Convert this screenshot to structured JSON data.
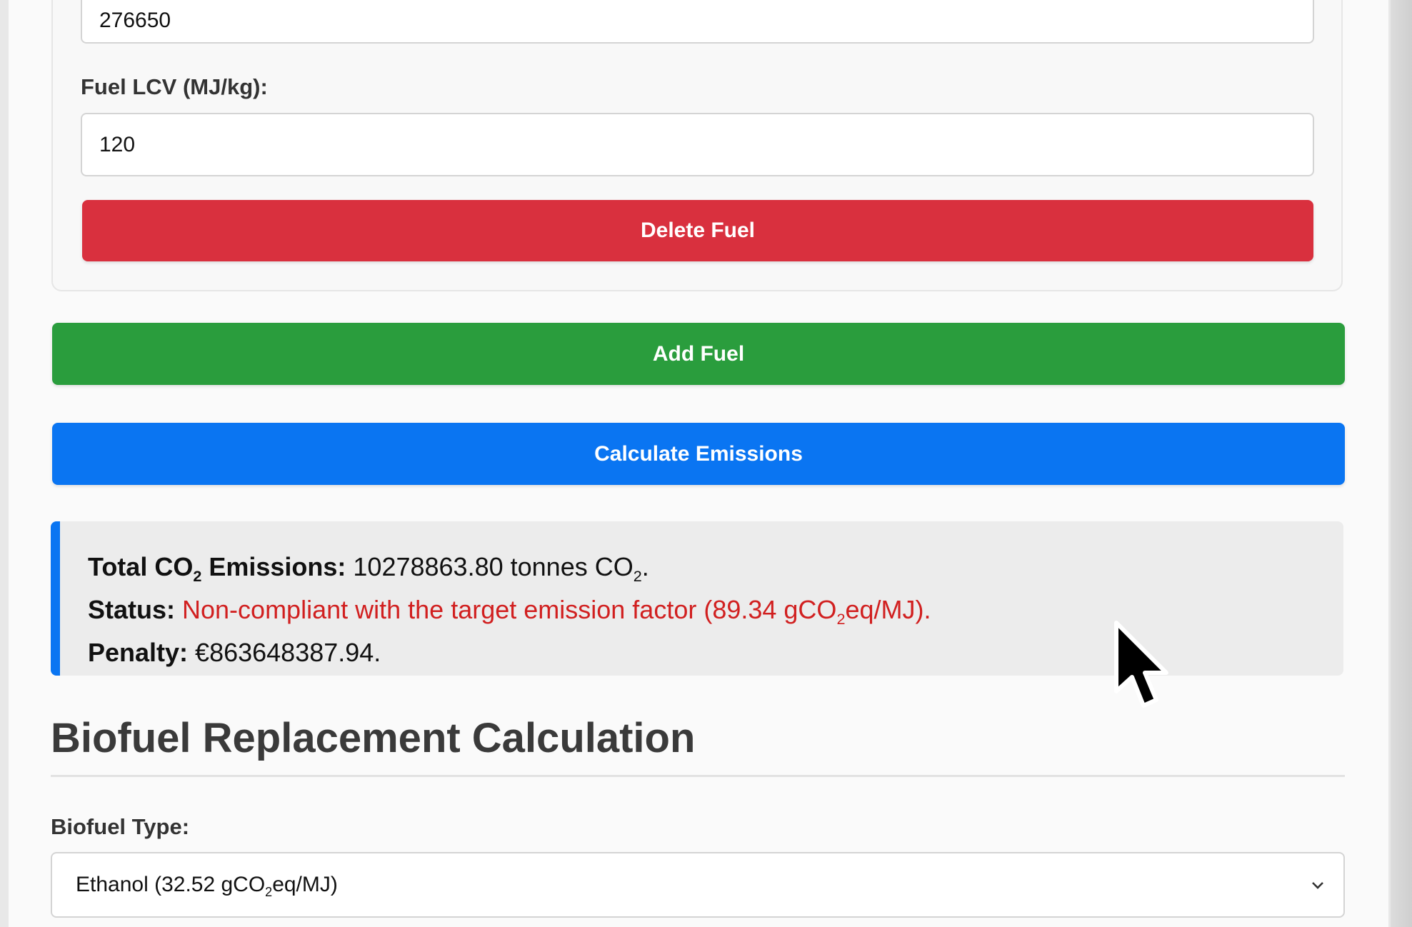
{
  "fuel_form": {
    "top_input_value": "276650",
    "lcv_label": "Fuel LCV (MJ/kg):",
    "lcv_value": "120",
    "delete_label": "Delete Fuel"
  },
  "actions": {
    "add_label": "Add Fuel",
    "calculate_label": "Calculate Emissions"
  },
  "results": {
    "total_label_prefix": "Total CO",
    "total_label_sub": "2",
    "total_label_suffix": " Emissions:",
    "total_value": " 10278863.80 tonnes CO",
    "total_unit_sub": "2",
    "total_end": ".",
    "status_label": "Status:",
    "status_text_prefix": " Non-compliant with the target emission factor (89.34 gCO",
    "status_text_sub": "2",
    "status_text_suffix": "eq/MJ).",
    "penalty_label": "Penalty:",
    "penalty_value": " €863648387.94."
  },
  "biofuel": {
    "section_title": "Biofuel Replacement Calculation",
    "type_label": "Biofuel Type:",
    "selected_prefix": "Ethanol (32.52 gCO",
    "selected_sub": "2",
    "selected_suffix": "eq/MJ)"
  },
  "colors": {
    "delete": "#d9303e",
    "add": "#2a9d3d",
    "calculate": "#0a75f2",
    "error_text": "#d11f1f"
  },
  "icons": {
    "select_arrow": "chevron-down-icon",
    "pointer": "mouse-cursor-icon"
  }
}
